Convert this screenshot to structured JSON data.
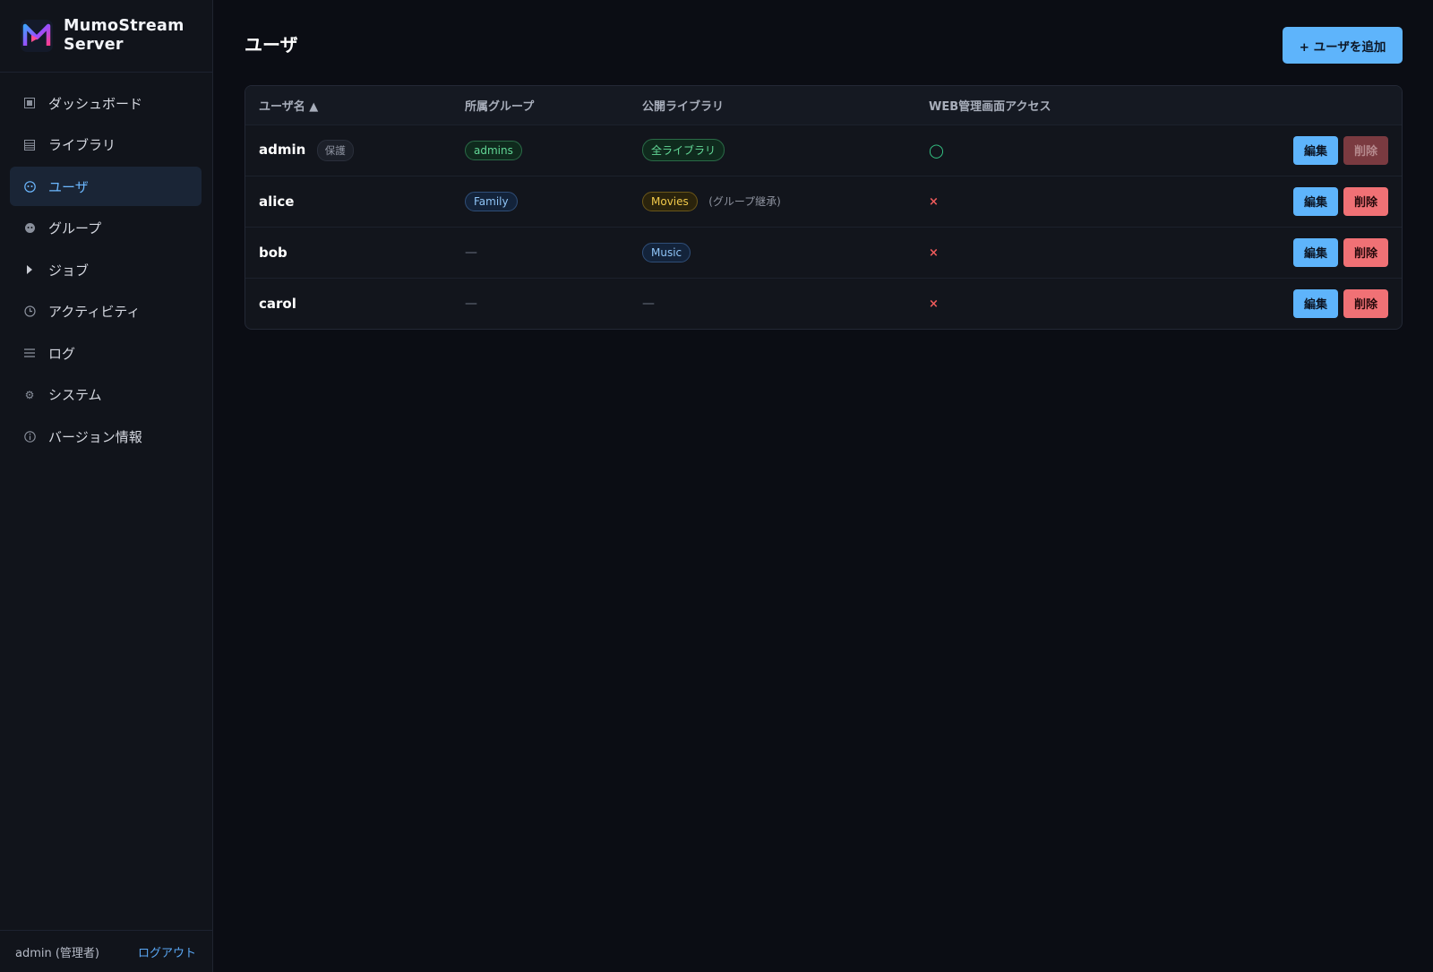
{
  "app": {
    "name_line1": "MumoStream",
    "name_line2": "Server"
  },
  "sidebar": {
    "items": [
      {
        "label": "ダッシュボード",
        "icon": "dashboard-icon",
        "active": false
      },
      {
        "label": "ライブラリ",
        "icon": "library-icon",
        "active": false
      },
      {
        "label": "ユーザ",
        "icon": "user-icon",
        "active": true
      },
      {
        "label": "グループ",
        "icon": "group-icon",
        "active": false
      },
      {
        "label": "ジョブ",
        "icon": "play-icon",
        "active": false
      },
      {
        "label": "アクティビティ",
        "icon": "clock-icon",
        "active": false
      },
      {
        "label": "ログ",
        "icon": "list-icon",
        "active": false
      },
      {
        "label": "システム",
        "icon": "gear-icon",
        "active": false
      },
      {
        "label": "バージョン情報",
        "icon": "info-icon",
        "active": false
      }
    ],
    "footer": {
      "user": "admin (管理者)",
      "logout": "ログアウト"
    }
  },
  "page": {
    "title": "ユーザ",
    "add_button": "+ ユーザを追加"
  },
  "table": {
    "headers": {
      "username": "ユーザ名 ▲",
      "group": "所属グループ",
      "library": "公開ライブラリ",
      "web_access": "WEB管理画面アクセス"
    },
    "rows": [
      {
        "username": "admin",
        "protect_badge": "保護",
        "group": "admins",
        "library": "全ライブラリ",
        "library_note": "",
        "web_access": "◯",
        "edit": "編集",
        "delete": "削除",
        "delete_disabled": true
      },
      {
        "username": "alice",
        "group": "Family",
        "library": "Movies",
        "library_note": "(グループ継承)",
        "web_access": "×",
        "edit": "編集",
        "delete": "削除"
      },
      {
        "username": "bob",
        "group": "—",
        "library": "Music",
        "library_note": "",
        "web_access": "×",
        "edit": "編集",
        "delete": "削除"
      },
      {
        "username": "carol",
        "group": "—",
        "library": "—",
        "library_note": "",
        "web_access": "×",
        "edit": "編集",
        "delete": "削除"
      }
    ]
  },
  "colors": {
    "accent": "#5eb4fb",
    "danger": "#f07175",
    "success": "#35c786",
    "background": "#0b0d14",
    "sidebar": "#11141b"
  }
}
